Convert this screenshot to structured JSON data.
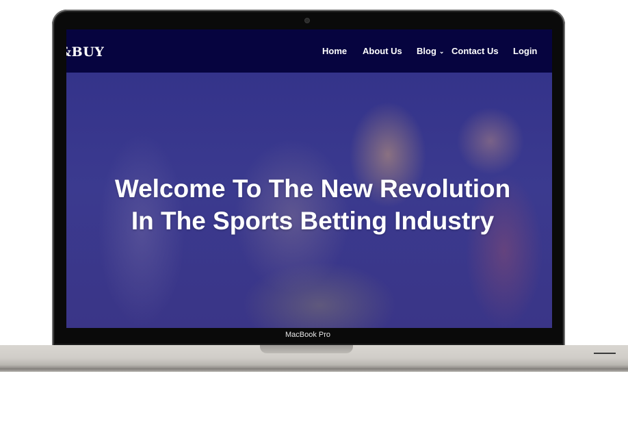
{
  "site": {
    "logo": "&BUY",
    "nav": {
      "home": "Home",
      "about": "About Us",
      "blog": "Blog",
      "contact": "Contact Us",
      "login": "Login"
    }
  },
  "hero": {
    "title_line1": "Welcome To The New Revolution",
    "title_line2": "In The Sports Betting Industry"
  },
  "device": {
    "label": "MacBook Pro"
  },
  "colors": {
    "navbar": "#06043f",
    "hero_overlay": "#2b2a78",
    "text": "#ffffff"
  },
  "icons": {
    "blog_dropdown": "chevron-down-icon"
  }
}
